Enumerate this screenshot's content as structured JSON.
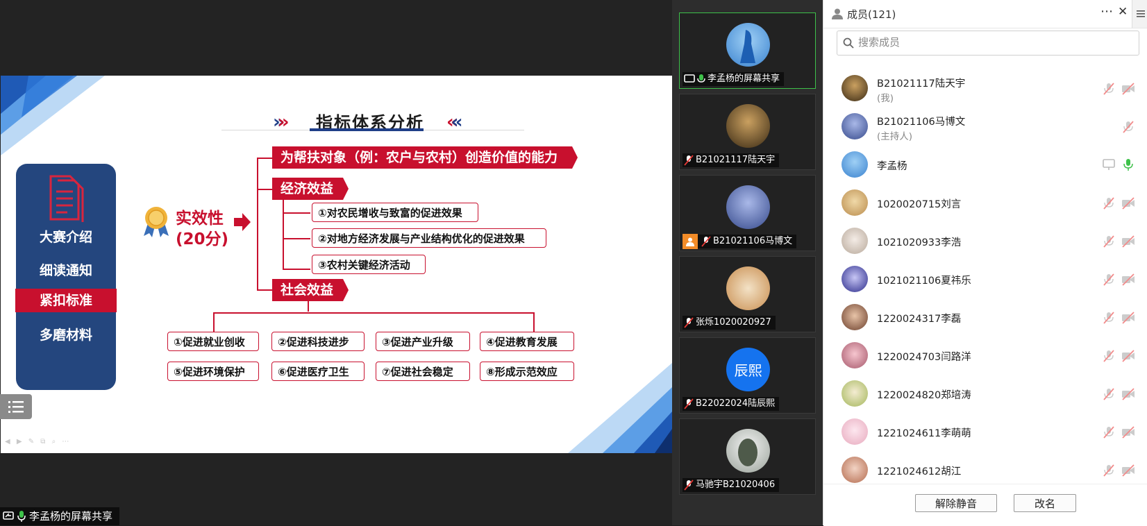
{
  "slide": {
    "title": "指标体系分析",
    "menu": [
      "大赛介绍",
      "细读通知",
      "紧扣标准",
      "多磨材料"
    ],
    "active_menu_index": 2,
    "effect_title": "实效性",
    "effect_score": "(20分)",
    "top_bar": "为帮扶对象（例：农户与农村）创造价值的能力",
    "economic_bar": "经济效益",
    "economic_items": [
      "①对农民增收与致富的促进效果",
      "②对地方经济发展与产业结构优化的促进效果",
      "③农村关键经济活动"
    ],
    "social_bar": "社会效益",
    "social_items": [
      "①促进就业创收",
      "②促进科技进步",
      "③促进产业升级",
      "④促进教育发展",
      "⑤促进环境保护",
      "⑥促进医疗卫生",
      "⑦促进社会稳定",
      "⑧形成示范效应"
    ]
  },
  "share_label": "李孟杨的屏幕共享",
  "video_tiles": [
    {
      "label": "李孟杨的屏幕共享",
      "screen_share": true,
      "mic": "on",
      "active": true
    },
    {
      "label": "B21021117陆天宇",
      "mic": "muted"
    },
    {
      "label": "B21021106马博文",
      "mic": "muted",
      "host_badge": true
    },
    {
      "label": "张烁1020020927",
      "mic": "muted"
    },
    {
      "label": "B22022024陆辰熙",
      "mic": "muted",
      "avatar_text": "辰熙"
    },
    {
      "label": "马驰宇B21020406",
      "mic": "muted"
    }
  ],
  "members_panel": {
    "title": "成员(121)",
    "search_placeholder": "搜索成员",
    "members": [
      {
        "name": "B21021117陆天宇",
        "sub": "(我)",
        "mic": "muted",
        "cam": "off"
      },
      {
        "name": "B21021106马博文",
        "sub": "(主持人)",
        "mic": "muted"
      },
      {
        "name": "李孟杨",
        "share": true,
        "mic": "on"
      },
      {
        "name": "1020020715刘言",
        "mic": "muted",
        "cam": "off"
      },
      {
        "name": "1021020933李浩",
        "mic": "muted",
        "cam": "off"
      },
      {
        "name": "1021021106夏祎乐",
        "mic": "muted",
        "cam": "off"
      },
      {
        "name": "1220024317李磊",
        "mic": "muted",
        "cam": "off"
      },
      {
        "name": "1220024703闫路洋",
        "mic": "muted",
        "cam": "off"
      },
      {
        "name": "1220024820郑培涛",
        "mic": "muted",
        "cam": "off"
      },
      {
        "name": "1221024611李萌萌",
        "mic": "muted",
        "cam": "off"
      },
      {
        "name": "1221024612胡江",
        "mic": "muted",
        "cam": "off"
      }
    ],
    "unmute_button": "解除静音",
    "rename_button": "改名"
  },
  "colors": {
    "accent_red": "#c8102e",
    "navy": "#24467e",
    "active_green": "#3ec14a",
    "host_orange": "#f28c28"
  }
}
